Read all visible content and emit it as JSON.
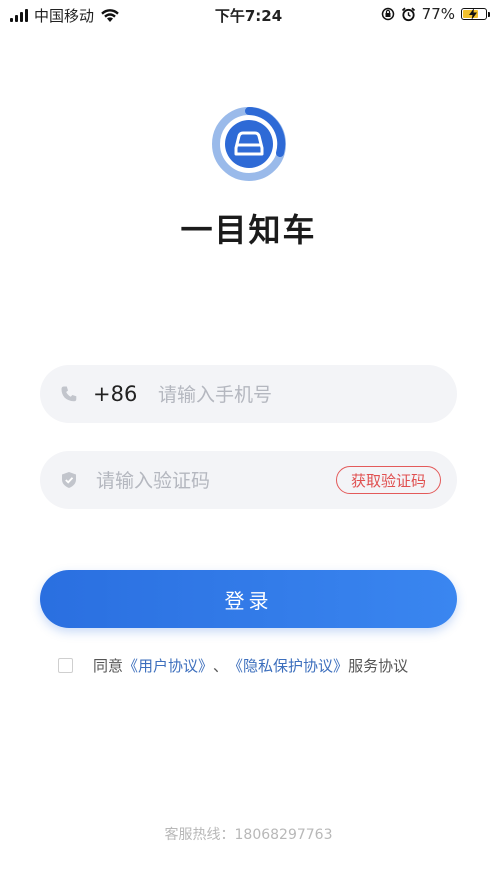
{
  "status_bar": {
    "carrier": "中国移动",
    "time": "下午7:24",
    "battery_percent": "77%",
    "battery_level": 0.77
  },
  "app": {
    "title": "一目知车"
  },
  "phone_field": {
    "prefix": "+86",
    "placeholder": "请输入手机号",
    "value": ""
  },
  "code_field": {
    "placeholder": "请输入验证码",
    "value": "",
    "get_code_label": "获取验证码"
  },
  "login_label": "登录",
  "agreement": {
    "checked": false,
    "prefix": "同意",
    "user_agreement": "《用户协议》",
    "separator": "、",
    "privacy_agreement": "《隐私保护协议》",
    "suffix": "服务协议"
  },
  "hotline": "客服热线：18068297763",
  "colors": {
    "primary": "#2a6fe0",
    "link": "#3d6fbd",
    "danger": "#e05050"
  }
}
